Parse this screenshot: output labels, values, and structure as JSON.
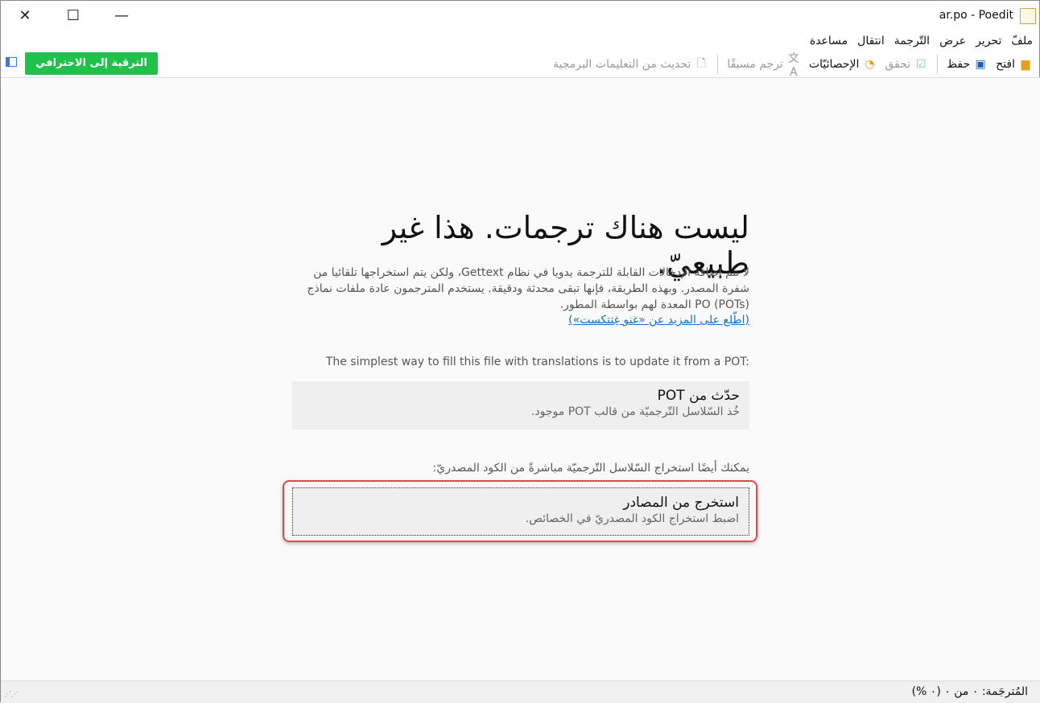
{
  "window": {
    "title": "ar.po - Poedit",
    "minimize": "—",
    "maximize": "☐",
    "close": "✕"
  },
  "menu": [
    "ملفّ",
    "تحرير",
    "عرض",
    "التّرجمة",
    "انتقال",
    "مساعدة"
  ],
  "toolbar": {
    "open": "افتح",
    "save": "حفظ",
    "validate": "تحقق",
    "stats": "الإحصائيّات",
    "pretranslate": "ترجم مسبقًا",
    "update_source": "تحديث من التعليمات البرمجية",
    "upgrade": "الترقية إلى الاحترافي"
  },
  "main": {
    "title": "ليست هناك ترجمات. هذا غير طبيعيّ.",
    "paragraph": "لا تتم إضافة الإدخالات القابلة للترجمة يدويا في نظام Gettext، ولكن يتم استخراجها تلقائيا من شفرة المصدر. وبهذه الطريقة، فإنها تبقى محدثة ودقيقة. يستخدم المترجمون عادة ملفات نماذج PO (POTs) المعدة لهم بواسطة المطور.",
    "link": "(اطّلع على المزيد عن «غنو غِتتكست»)",
    "pot_hint": "The simplest way to fill this file with translations is to update it from a POT:",
    "update_pot": {
      "title": "حدّث من POT",
      "subtitle": "خُذ السّلاسل التّرجميّة من قالب POT موجود."
    },
    "source_hint": "يمكنك أيضًا استخراج السّلاسل التّرجميّة مباشرةً من الكود المصدريّ:",
    "extract": {
      "title": "استخرج من المصادر",
      "subtitle": "اضبط استخراج الكود المصدريّ في الخصائص."
    }
  },
  "status": {
    "translated": "المُترجَمة: ٠ من ٠ (٠ %)"
  },
  "colors": {
    "upgrade": "#1ec24a",
    "highlight": "#e04848",
    "link": "#1a6fd6"
  }
}
